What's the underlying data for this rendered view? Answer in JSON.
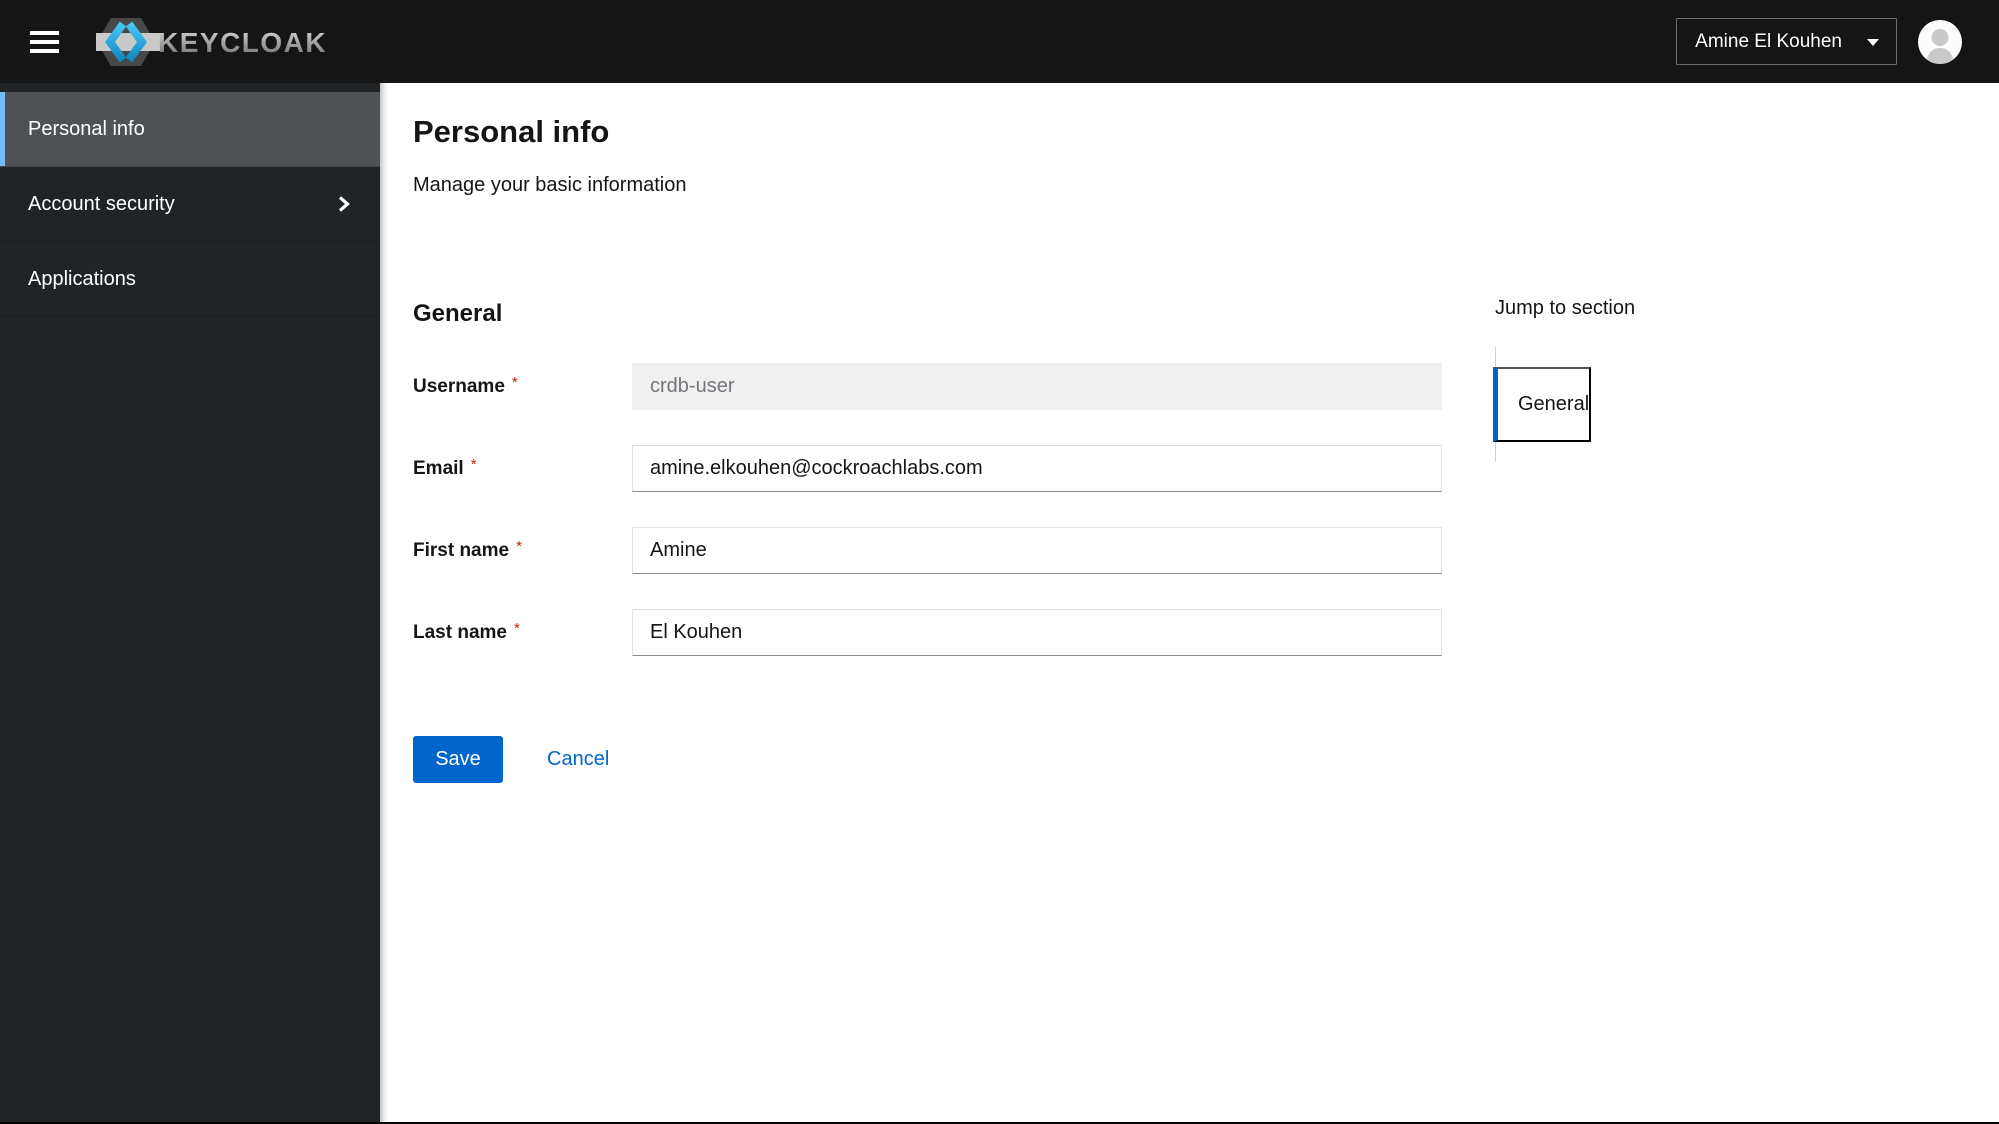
{
  "colors": {
    "masthead_bg": "#151515",
    "sidebar_bg": "#212427",
    "sidebar_selected_bg": "#4f5255",
    "nav_active_indicator": "#73bcf7",
    "accent_blue": "#0066cc",
    "required_red": "#c9190b",
    "disabled_input_bg": "#f0f0f0"
  },
  "masthead": {
    "brand": "KEYCLOAK",
    "menu_icon": "hamburger-icon",
    "user_menu": {
      "label": "Amine El Kouhen",
      "caret_icon": "caret-down-icon"
    },
    "avatar_icon": "user-avatar-icon"
  },
  "sidebar": {
    "items": [
      {
        "label": "Personal info",
        "selected": true
      },
      {
        "label": "Account security",
        "has_submenu": true
      },
      {
        "label": "Applications"
      }
    ]
  },
  "page": {
    "title": "Personal info",
    "subtitle": "Manage your basic information"
  },
  "form": {
    "section_title": "General",
    "required_indicator": "*",
    "fields": [
      {
        "label": "Username",
        "value": "crdb-user",
        "required": true,
        "disabled": true
      },
      {
        "label": "Email",
        "value": "amine.elkouhen@cockroachlabs.com",
        "required": true
      },
      {
        "label": "First name",
        "value": "Amine",
        "required": true
      },
      {
        "label": "Last name",
        "value": "El Kouhen",
        "required": true
      }
    ],
    "actions": {
      "save": "Save",
      "cancel": "Cancel"
    }
  },
  "jump_to": {
    "title": "Jump to section",
    "items": [
      {
        "label": "General",
        "active": true
      }
    ]
  }
}
